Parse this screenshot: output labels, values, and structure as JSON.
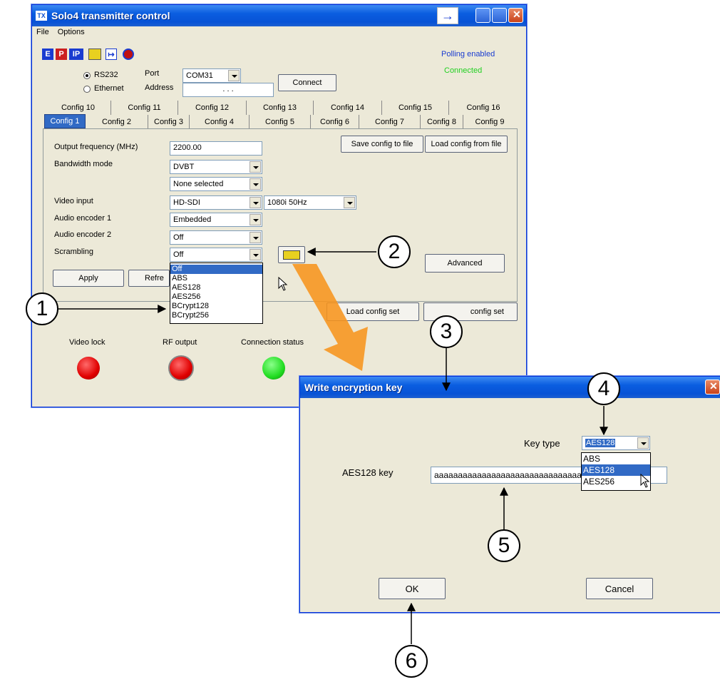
{
  "main_window": {
    "title": "Solo4 transmitter control",
    "menu": [
      "File",
      "Options"
    ],
    "toolbar_icons": [
      "E",
      "P",
      "IP"
    ],
    "status_polling": "Polling enabled",
    "status_connected": "Connected",
    "connection": {
      "rs232_label": "RS232",
      "ethernet_label": "Ethernet",
      "port_label": "Port",
      "port_value": "COM31",
      "address_label": "Address",
      "address_value": ". . .",
      "connect_button": "Connect"
    },
    "tabs_row1": [
      "Config 10",
      "Config 11",
      "Config 12",
      "Config 13",
      "Config 14",
      "Config 15",
      "Config 16"
    ],
    "tabs_row2": [
      "Config 1",
      "Config 2",
      "Config 3",
      "Config 4",
      "Config 5",
      "Config 6",
      "Config 7",
      "Config 8",
      "Config 9"
    ],
    "form": {
      "output_frequency_label": "Output frequency (MHz)",
      "output_frequency_value": "2200.00",
      "bandwidth_mode_label": "Bandwidth mode",
      "bandwidth_mode_value": "DVBT",
      "bandwidth_sub_value": "None selected",
      "video_input_label": "Video input",
      "video_input_value": "HD-SDI",
      "video_format_value": "1080i 50Hz",
      "audio_encoder1_label": "Audio encoder 1",
      "audio_encoder1_value": "Embedded",
      "audio_encoder2_label": "Audio encoder 2",
      "audio_encoder2_value": "Off",
      "scrambling_label": "Scrambling",
      "scrambling_value": "Off",
      "scrambling_options": [
        "Off",
        "ABS",
        "AES128",
        "AES256",
        "BCrypt128",
        "BCrypt256"
      ]
    },
    "buttons": {
      "save_config": "Save config to file",
      "load_config": "Load config from file",
      "advanced": "Advanced",
      "apply": "Apply",
      "refresh": "Refre",
      "load_config_set": "Load config set",
      "save_config_set": "config set"
    },
    "indicators": {
      "video_lock_label": "Video lock",
      "rf_output_label": "RF output",
      "connection_status_label": "Connection status"
    },
    "colors": {
      "led_red": "#e00000",
      "led_green": "#22dd22",
      "status_blue": "#1a3cd0",
      "status_green": "#20d020"
    }
  },
  "dialog": {
    "title": "Write encryption key",
    "key_type_label": "Key type",
    "key_type_value": "AES128",
    "key_type_options": [
      "ABS",
      "AES128",
      "AES256"
    ],
    "key_label": "AES128 key",
    "key_value": "aaaaaaaaaaaaaaaaaaaaaaaaaaaaaaa",
    "ok_button": "OK",
    "cancel_button": "Cancel"
  },
  "callouts": [
    "1",
    "2",
    "3",
    "4",
    "5",
    "6"
  ],
  "arrow_color": "#f7941d"
}
